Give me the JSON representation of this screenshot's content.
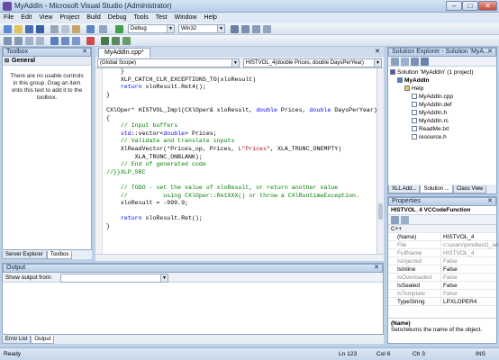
{
  "window": {
    "title": "MyAddIn - Microsoft Visual Studio (Administrator)"
  },
  "menu": [
    "File",
    "Edit",
    "View",
    "Project",
    "Build",
    "Debug",
    "Tools",
    "Test",
    "Window",
    "Help"
  ],
  "toolbar": {
    "config": "Debug",
    "platform": "Win32"
  },
  "toolbox": {
    "title": "Toolbox",
    "section": "General",
    "message": "There are no usable controls in this group. Drag an item onto this text to add it to the toolbox.",
    "tabs": [
      "Server Explorer",
      "Toolbox"
    ]
  },
  "editor": {
    "tab": "MyAddIn.cpp*",
    "scope": "(Global Scope)",
    "member": "HISTVOL_4(double Prices, double DaysPerYear)",
    "lines": [
      {
        "t": "    }",
        "c": ""
      },
      {
        "t": "    XLP_CATCH_CLR_EXCEPTIONS_TO(xloResult)",
        "c": ""
      },
      {
        "t": "    return xloResult.Ret4();",
        "c": "kwfirst"
      },
      {
        "t": "}",
        "c": ""
      },
      {
        "t": "",
        "c": ""
      },
      {
        "t": "CXlOper* HISTVOL_Impl(CXlOper& xloResult, double Prices, double DaysPerYear)",
        "c": "sig"
      },
      {
        "t": "{",
        "c": ""
      },
      {
        "t": "    // Input buffers",
        "c": "cm"
      },
      {
        "t": "    std::vector<double> Prices;",
        "c": "vec"
      },
      {
        "t": "    // Validate and translate inputs",
        "c": "cm"
      },
      {
        "t": "    XlReadVector(*Prices_op, Prices, L\"Prices\", XLA_TRUNC_ONEMPTY|",
        "c": "str"
      },
      {
        "t": "        XLA_TRUNC_ONBLANK);",
        "c": ""
      },
      {
        "t": "    // End of generated code",
        "c": "cm"
      },
      {
        "t": "//}}XLP_SRC",
        "c": "cm"
      },
      {
        "t": "",
        "c": ""
      },
      {
        "t": "    // TODO - set the value of xloResult, or return another value",
        "c": "cm"
      },
      {
        "t": "    //          using CXlOper::RetXXX() or throw a CXlRuntimeException.",
        "c": "cm"
      },
      {
        "t": "    xloResult = -999.9;",
        "c": ""
      },
      {
        "t": "",
        "c": ""
      },
      {
        "t": "    return xloResult.Ret();",
        "c": "kwfirst"
      },
      {
        "t": "}",
        "c": ""
      }
    ]
  },
  "solution": {
    "title": "Solution Explorer - Solution 'MyA...",
    "items": [
      "Solution 'MyAddIn' (1 project)",
      "MyAddIn",
      "Help",
      "MyAddIn.cpp",
      "MyAddIn.def",
      "MyAddIn.h",
      "MyAddIn.rc",
      "ReadMe.txt",
      "resource.h"
    ],
    "tabs": [
      "XLL Add...",
      "Solution ...",
      "Class View"
    ]
  },
  "properties": {
    "title": "Properties",
    "object": "HISTVOL_4 VCCodeFunction",
    "category": "C++",
    "rows": [
      {
        "k": "(Name)",
        "v": "HISTVOL_4",
        "dim": false
      },
      {
        "k": "File",
        "v": "c:\\users\\prodtest1_adm...",
        "dim": true
      },
      {
        "k": "FullName",
        "v": "HISTVOL_4",
        "dim": true
      },
      {
        "k": "IsInjected",
        "v": "False",
        "dim": true
      },
      {
        "k": "IsInline",
        "v": "False",
        "dim": false
      },
      {
        "k": "IsOverloaded",
        "v": "False",
        "dim": true
      },
      {
        "k": "IsSealed",
        "v": "False",
        "dim": false
      },
      {
        "k": "IsTemplate",
        "v": "False",
        "dim": true
      },
      {
        "k": "TypeString",
        "v": "LPXLOPER4",
        "dim": false
      }
    ],
    "descTitle": "(Name)",
    "desc": "Sets/returns the name of the object."
  },
  "output": {
    "title": "Output",
    "showLabel": "Show output from:",
    "tabs": [
      "Error List",
      "Output"
    ]
  },
  "status": {
    "text": "Ready",
    "ln": "Ln 123",
    "col": "Col 6",
    "ch": "Ch 3",
    "ins": "INS"
  }
}
